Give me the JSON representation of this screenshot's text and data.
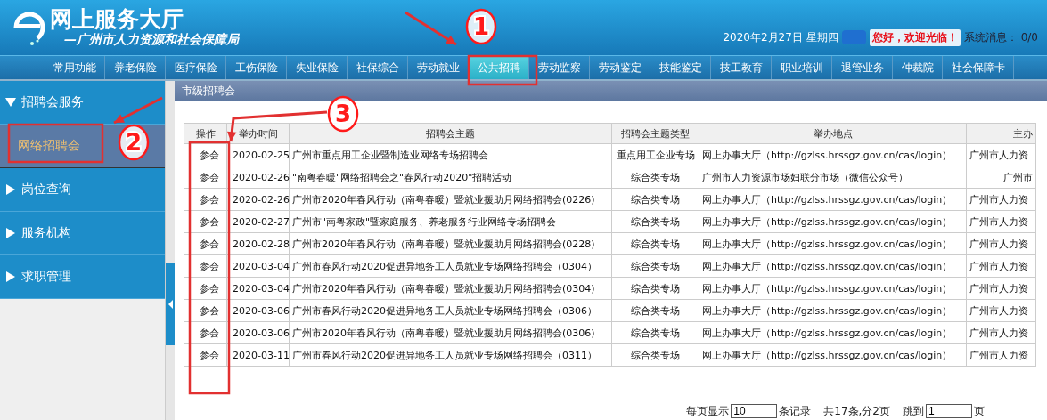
{
  "header": {
    "title": "网上服务大厅",
    "subtitle": "—广州市人力资源和社会保障局",
    "date": "2020年2月27日 星期四",
    "greeting": "您好，欢迎光临！",
    "messages_label": "系统消息：",
    "messages_count": "0/0"
  },
  "nav": [
    {
      "label": "常用功能",
      "selected": false
    },
    {
      "label": "养老保险",
      "selected": false
    },
    {
      "label": "医疗保险",
      "selected": false
    },
    {
      "label": "工伤保险",
      "selected": false
    },
    {
      "label": "失业保险",
      "selected": false
    },
    {
      "label": "社保综合",
      "selected": false
    },
    {
      "label": "劳动就业",
      "selected": false
    },
    {
      "label": "公共招聘",
      "selected": true
    },
    {
      "label": "劳动监察",
      "selected": false
    },
    {
      "label": "劳动鉴定",
      "selected": false
    },
    {
      "label": "技能鉴定",
      "selected": false
    },
    {
      "label": "技工教育",
      "selected": false
    },
    {
      "label": "职业培训",
      "selected": false
    },
    {
      "label": "退管业务",
      "selected": false
    },
    {
      "label": "仲裁院",
      "selected": false
    },
    {
      "label": "社会保障卡",
      "selected": false
    }
  ],
  "sidebar": [
    {
      "label": "招聘会服务",
      "expanded": true,
      "children": [
        {
          "label": "网络招聘会",
          "selected": true
        }
      ]
    },
    {
      "label": "岗位查询",
      "expanded": false
    },
    {
      "label": "服务机构",
      "expanded": false
    },
    {
      "label": "求职管理",
      "expanded": false
    }
  ],
  "panel": {
    "title": "市级招聘会"
  },
  "table": {
    "columns": [
      "操作",
      "举办时间",
      "招聘会主题",
      "招聘会主题类型",
      "举办地点",
      "主办"
    ],
    "rows": [
      {
        "action": "参会",
        "date": "2020-02-25",
        "topic": "广州市重点用工企业暨制造业网络专场招聘会",
        "type": "重点用工企业专场",
        "place": "网上办事大厅（http://gzlss.hrssgz.gov.cn/cas/login）",
        "organizer": "广州市人力资"
      },
      {
        "action": "参会",
        "date": "2020-02-26",
        "topic": "\"南粤春暖\"网络招聘会之\"春风行动2020\"招聘活动",
        "type": "综合类专场",
        "place": "广州市人力资源市场妇联分市场（微信公众号）",
        "organizer": "广州市"
      },
      {
        "action": "参会",
        "date": "2020-02-26",
        "topic": "广州市2020年春风行动（南粤春暖）暨就业援助月网络招聘会(0226)",
        "type": "综合类专场",
        "place": "网上办事大厅（http://gzlss.hrssgz.gov.cn/cas/login）",
        "organizer": "广州市人力资"
      },
      {
        "action": "参会",
        "date": "2020-02-27",
        "topic": "广州市\"南粤家政\"暨家庭服务、养老服务行业网络专场招聘会",
        "type": "综合类专场",
        "place": "网上办事大厅（http://gzlss.hrssgz.gov.cn/cas/login）",
        "organizer": "广州市人力资"
      },
      {
        "action": "参会",
        "date": "2020-02-28",
        "topic": "广州市2020年春风行动（南粤春暖）暨就业援助月网络招聘会(0228)",
        "type": "综合类专场",
        "place": "网上办事大厅（http://gzlss.hrssgz.gov.cn/cas/login）",
        "organizer": "广州市人力资"
      },
      {
        "action": "参会",
        "date": "2020-03-04",
        "topic": "广州市春风行动2020促进异地务工人员就业专场网络招聘会（0304）",
        "type": "综合类专场",
        "place": "网上办事大厅（http://gzlss.hrssgz.gov.cn/cas/login）",
        "organizer": "广州市人力资"
      },
      {
        "action": "参会",
        "date": "2020-03-04",
        "topic": "广州市2020年春风行动（南粤春暖）暨就业援助月网络招聘会(0304)",
        "type": "综合类专场",
        "place": "网上办事大厅（http://gzlss.hrssgz.gov.cn/cas/login）",
        "organizer": "广州市人力资"
      },
      {
        "action": "参会",
        "date": "2020-03-06",
        "topic": "广州市春风行动2020促进异地务工人员就业专场网络招聘会（0306）",
        "type": "综合类专场",
        "place": "网上办事大厅（http://gzlss.hrssgz.gov.cn/cas/login）",
        "organizer": "广州市人力资"
      },
      {
        "action": "参会",
        "date": "2020-03-06",
        "topic": "广州市2020年春风行动（南粤春暖）暨就业援助月网络招聘会(0306)",
        "type": "综合类专场",
        "place": "网上办事大厅（http://gzlss.hrssgz.gov.cn/cas/login）",
        "organizer": "广州市人力资"
      },
      {
        "action": "参会",
        "date": "2020-03-11",
        "topic": "广州市春风行动2020促进异地务工人员就业专场网络招聘会（0311）",
        "type": "综合类专场",
        "place": "网上办事大厅（http://gzlss.hrssgz.gov.cn/cas/login）",
        "organizer": "广州市人力资"
      }
    ]
  },
  "pagination": {
    "per_page_label": "每页显示",
    "per_page_value": "10",
    "records_label": "条记录",
    "summary": "共17条,分2页",
    "jump_label": "跳到",
    "jump_value": "1",
    "page_label": "页"
  },
  "annotations": [
    {
      "label": "1"
    },
    {
      "label": "2"
    },
    {
      "label": "3"
    }
  ]
}
